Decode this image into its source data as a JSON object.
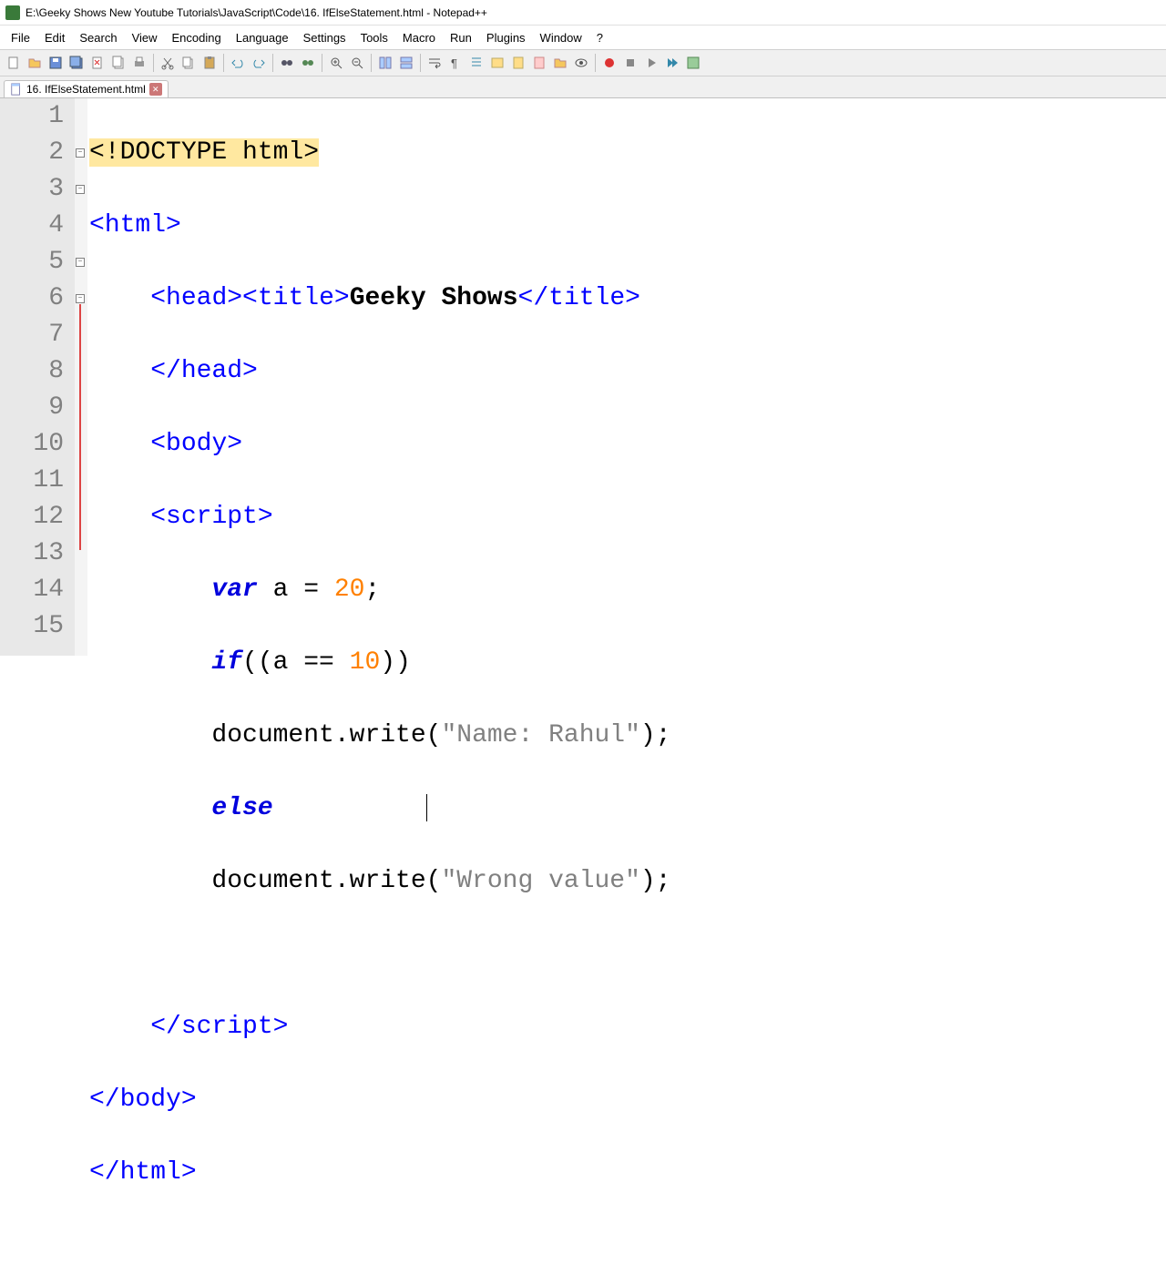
{
  "titlebar": {
    "path": "E:\\Geeky Shows New Youtube Tutorials\\JavaScript\\Code\\16. IfElseStatement.html - Notepad++"
  },
  "menu": [
    "File",
    "Edit",
    "Search",
    "View",
    "Encoding",
    "Language",
    "Settings",
    "Tools",
    "Macro",
    "Run",
    "Plugins",
    "Window",
    "?"
  ],
  "tab": {
    "name": "16. IfElseStatement.html"
  },
  "lines": [
    "1",
    "2",
    "3",
    "4",
    "5",
    "6",
    "7",
    "8",
    "9",
    "10",
    "11",
    "12",
    "13",
    "14",
    "15"
  ],
  "code": {
    "l1_doctype": "<!DOCTYPE html>",
    "l2_open": "<",
    "l2_tag": "html",
    "l2_close": ">",
    "l3_open1": "<",
    "l3_tag1": "head",
    "l3_close1": "><",
    "l3_tag2": "title",
    "l3_close2": ">",
    "l3_text": "Geeky Shows",
    "l3_open3": "</",
    "l3_tag3": "title",
    "l3_close3": ">",
    "l4_open": "</",
    "l4_tag": "head",
    "l4_close": ">",
    "l5_open": "<",
    "l5_tag": "body",
    "l5_close": ">",
    "l6_open": "<",
    "l6_tag": "script",
    "l6_close": ">",
    "l7_var": "var",
    "l7_rest1": " a = ",
    "l7_num": "20",
    "l7_semi": ";",
    "l8_if": "if",
    "l8_paren1": "((a == ",
    "l8_num": "10",
    "l8_paren2": "))",
    "l9_doc": "document.write(",
    "l9_str": "\"Name: Rahul\"",
    "l9_end": ");",
    "l10_else": "else",
    "l11_doc": "document.write(",
    "l11_str": "\"Wrong value\"",
    "l11_end": ");",
    "l13_open": "</",
    "l13_tag": "script",
    "l13_close": ">",
    "l14_open": "</",
    "l14_tag": "body",
    "l14_close": ">",
    "l15_open": "</",
    "l15_tag": "html",
    "l15_close": ">"
  }
}
